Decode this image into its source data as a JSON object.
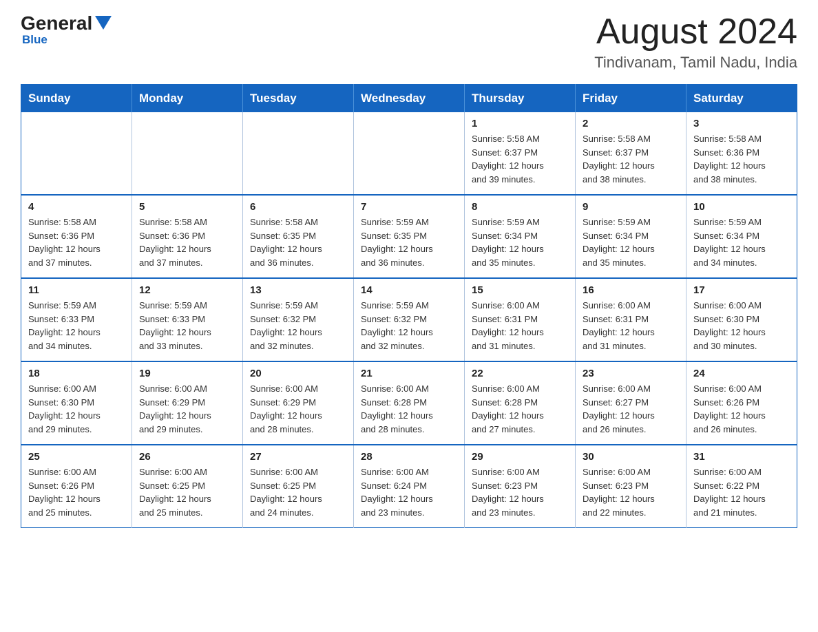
{
  "header": {
    "logo_general": "General",
    "logo_blue": "Blue",
    "month_title": "August 2024",
    "location": "Tindivanam, Tamil Nadu, India"
  },
  "calendar": {
    "days_of_week": [
      "Sunday",
      "Monday",
      "Tuesday",
      "Wednesday",
      "Thursday",
      "Friday",
      "Saturday"
    ],
    "weeks": [
      [
        {
          "day": "",
          "info": ""
        },
        {
          "day": "",
          "info": ""
        },
        {
          "day": "",
          "info": ""
        },
        {
          "day": "",
          "info": ""
        },
        {
          "day": "1",
          "info": "Sunrise: 5:58 AM\nSunset: 6:37 PM\nDaylight: 12 hours\nand 39 minutes."
        },
        {
          "day": "2",
          "info": "Sunrise: 5:58 AM\nSunset: 6:37 PM\nDaylight: 12 hours\nand 38 minutes."
        },
        {
          "day": "3",
          "info": "Sunrise: 5:58 AM\nSunset: 6:36 PM\nDaylight: 12 hours\nand 38 minutes."
        }
      ],
      [
        {
          "day": "4",
          "info": "Sunrise: 5:58 AM\nSunset: 6:36 PM\nDaylight: 12 hours\nand 37 minutes."
        },
        {
          "day": "5",
          "info": "Sunrise: 5:58 AM\nSunset: 6:36 PM\nDaylight: 12 hours\nand 37 minutes."
        },
        {
          "day": "6",
          "info": "Sunrise: 5:58 AM\nSunset: 6:35 PM\nDaylight: 12 hours\nand 36 minutes."
        },
        {
          "day": "7",
          "info": "Sunrise: 5:59 AM\nSunset: 6:35 PM\nDaylight: 12 hours\nand 36 minutes."
        },
        {
          "day": "8",
          "info": "Sunrise: 5:59 AM\nSunset: 6:34 PM\nDaylight: 12 hours\nand 35 minutes."
        },
        {
          "day": "9",
          "info": "Sunrise: 5:59 AM\nSunset: 6:34 PM\nDaylight: 12 hours\nand 35 minutes."
        },
        {
          "day": "10",
          "info": "Sunrise: 5:59 AM\nSunset: 6:34 PM\nDaylight: 12 hours\nand 34 minutes."
        }
      ],
      [
        {
          "day": "11",
          "info": "Sunrise: 5:59 AM\nSunset: 6:33 PM\nDaylight: 12 hours\nand 34 minutes."
        },
        {
          "day": "12",
          "info": "Sunrise: 5:59 AM\nSunset: 6:33 PM\nDaylight: 12 hours\nand 33 minutes."
        },
        {
          "day": "13",
          "info": "Sunrise: 5:59 AM\nSunset: 6:32 PM\nDaylight: 12 hours\nand 32 minutes."
        },
        {
          "day": "14",
          "info": "Sunrise: 5:59 AM\nSunset: 6:32 PM\nDaylight: 12 hours\nand 32 minutes."
        },
        {
          "day": "15",
          "info": "Sunrise: 6:00 AM\nSunset: 6:31 PM\nDaylight: 12 hours\nand 31 minutes."
        },
        {
          "day": "16",
          "info": "Sunrise: 6:00 AM\nSunset: 6:31 PM\nDaylight: 12 hours\nand 31 minutes."
        },
        {
          "day": "17",
          "info": "Sunrise: 6:00 AM\nSunset: 6:30 PM\nDaylight: 12 hours\nand 30 minutes."
        }
      ],
      [
        {
          "day": "18",
          "info": "Sunrise: 6:00 AM\nSunset: 6:30 PM\nDaylight: 12 hours\nand 29 minutes."
        },
        {
          "day": "19",
          "info": "Sunrise: 6:00 AM\nSunset: 6:29 PM\nDaylight: 12 hours\nand 29 minutes."
        },
        {
          "day": "20",
          "info": "Sunrise: 6:00 AM\nSunset: 6:29 PM\nDaylight: 12 hours\nand 28 minutes."
        },
        {
          "day": "21",
          "info": "Sunrise: 6:00 AM\nSunset: 6:28 PM\nDaylight: 12 hours\nand 28 minutes."
        },
        {
          "day": "22",
          "info": "Sunrise: 6:00 AM\nSunset: 6:28 PM\nDaylight: 12 hours\nand 27 minutes."
        },
        {
          "day": "23",
          "info": "Sunrise: 6:00 AM\nSunset: 6:27 PM\nDaylight: 12 hours\nand 26 minutes."
        },
        {
          "day": "24",
          "info": "Sunrise: 6:00 AM\nSunset: 6:26 PM\nDaylight: 12 hours\nand 26 minutes."
        }
      ],
      [
        {
          "day": "25",
          "info": "Sunrise: 6:00 AM\nSunset: 6:26 PM\nDaylight: 12 hours\nand 25 minutes."
        },
        {
          "day": "26",
          "info": "Sunrise: 6:00 AM\nSunset: 6:25 PM\nDaylight: 12 hours\nand 25 minutes."
        },
        {
          "day": "27",
          "info": "Sunrise: 6:00 AM\nSunset: 6:25 PM\nDaylight: 12 hours\nand 24 minutes."
        },
        {
          "day": "28",
          "info": "Sunrise: 6:00 AM\nSunset: 6:24 PM\nDaylight: 12 hours\nand 23 minutes."
        },
        {
          "day": "29",
          "info": "Sunrise: 6:00 AM\nSunset: 6:23 PM\nDaylight: 12 hours\nand 23 minutes."
        },
        {
          "day": "30",
          "info": "Sunrise: 6:00 AM\nSunset: 6:23 PM\nDaylight: 12 hours\nand 22 minutes."
        },
        {
          "day": "31",
          "info": "Sunrise: 6:00 AM\nSunset: 6:22 PM\nDaylight: 12 hours\nand 21 minutes."
        }
      ]
    ]
  }
}
